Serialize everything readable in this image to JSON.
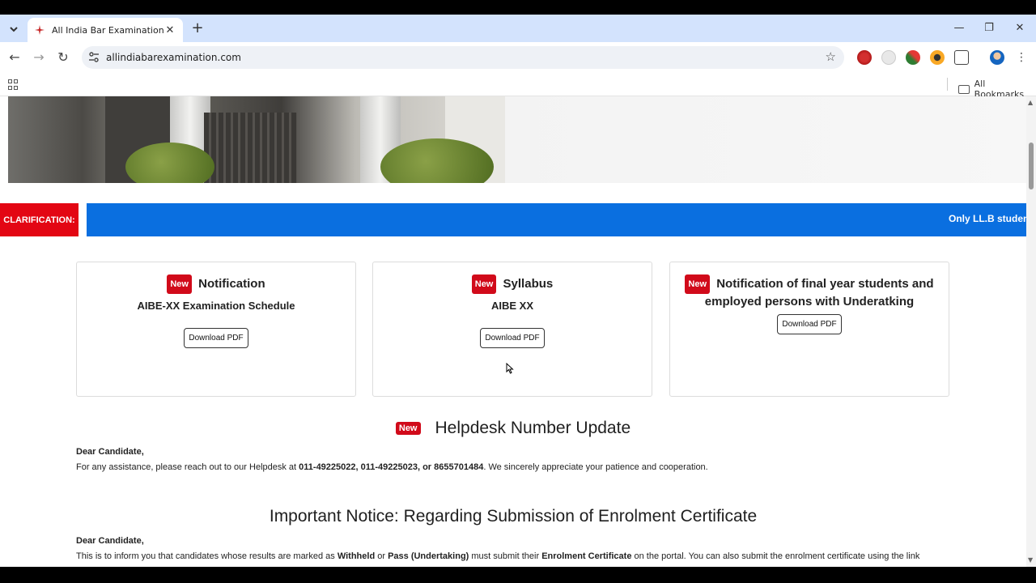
{
  "browser": {
    "tab_title": "All India Bar Examination",
    "url": "allindiabarexamination.com",
    "bookmarks_label": "All Bookmarks"
  },
  "ticker": {
    "label": "CLARIFICATION:",
    "text": "Only LL.B student"
  },
  "cards": [
    {
      "badge": "New",
      "title": "Notification",
      "subtitle": "AIBE-XX Examination Schedule",
      "button": "Download PDF"
    },
    {
      "badge": "New",
      "title": "Syllabus",
      "subtitle": "AIBE XX",
      "button": "Download PDF"
    },
    {
      "badge": "New",
      "title": "Notification of final year students and employed persons with Underatking",
      "button": "Download PDF"
    }
  ],
  "helpdesk": {
    "badge": "New",
    "title": "Helpdesk Number Update",
    "greeting": "Dear Candidate,",
    "text_before": "For any assistance, please reach out to our Helpdesk at ",
    "numbers": "011-49225022, 011-49225023, or 8655701484",
    "text_after": ". We sincerely appreciate your patience and cooperation."
  },
  "notice": {
    "title": "Important Notice: Regarding Submission of Enrolment Certificate",
    "greeting": "Dear Candidate,",
    "t1": "This is to inform you that candidates whose results are marked as ",
    "b1": "Withheld",
    "t2": " or ",
    "b2": "Pass (Undertaking)",
    "t3": " must submit their ",
    "b3": "Enrolment Certificate",
    "t4": " on the portal. You can also submit the enrolment certificate using the link"
  },
  "colors": {
    "clarification_red": "#e30613",
    "ticker_blue": "#0a6fe0",
    "badge_red": "#d10a1a"
  }
}
